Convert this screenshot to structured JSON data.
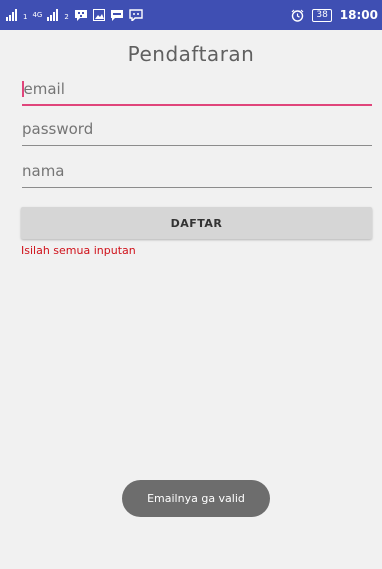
{
  "status_bar": {
    "sim1_slot": "1",
    "network_type": "4G",
    "sim2_slot": "2",
    "battery_level": "38",
    "time": "18:00"
  },
  "form": {
    "title": "Pendaftaran",
    "email_placeholder": "email",
    "password_placeholder": "password",
    "name_placeholder": "nama",
    "submit_label": "DAFTAR",
    "error_message": "Isilah semua inputan"
  },
  "toast": {
    "message": "Emailnya ga valid"
  },
  "colors": {
    "status_bar": "#3f4fb3",
    "accent": "#e0457b",
    "error": "#d0111a"
  }
}
